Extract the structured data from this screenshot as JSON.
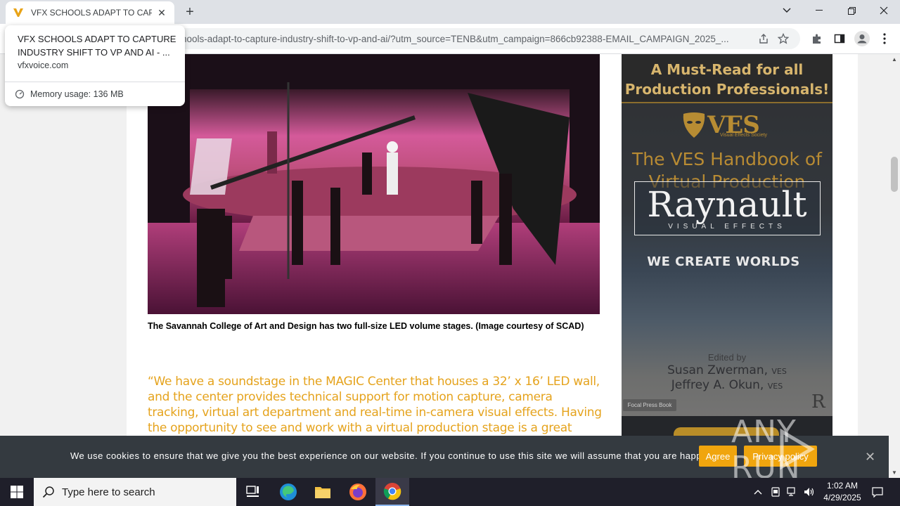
{
  "browser": {
    "tab_title": "VFX SCHOOLS ADAPT TO CAPTU",
    "url": "hools-adapt-to-capture-industry-shift-to-vp-and-ai/?utm_source=TENB&utm_campaign=866cb92388-EMAIL_CAMPAIGN_2025_...",
    "hover_card": {
      "title": "VFX SCHOOLS ADAPT TO CAPTURE INDUSTRY SHIFT TO VP AND AI - ...",
      "domain": "vfxvoice.com",
      "memory": "Memory usage: 136 MB"
    }
  },
  "article": {
    "caption": "The Savannah College of Art and Design has two full-size LED volume stages. (Image courtesy of SCAD)",
    "quote": "“We have a soundstage in the MAGIC Center that houses a 32’ x 16’ LED wall, and the center provides technical support for motion capture, camera tracking, virtual art department and real-time in-camera visual effects. Having the opportunity to see and work with a virtual production stage is a great asset for our graduates.”"
  },
  "ad": {
    "headline": "A Must-Read for all Production Professionals!",
    "ves_logo": "VES",
    "ves_sub": "Visual Effects Society",
    "book_title": "The VES Handbook of Virtual Production",
    "brand": "Raynault",
    "brand_sub": "VISUAL EFFECTS",
    "tagline": "WE CREATE WORLDS",
    "edited_by": "Edited by",
    "author1": "Susan Zwerman,",
    "author2": "Jeffrey A. Okun,",
    "author_suffix": "VES",
    "publisher": "Focal Press Book"
  },
  "cookie": {
    "text": "We use cookies to ensure that we give you the best experience on our website. If you continue to use this site we will assume that you are happy with it.",
    "agree": "Agree",
    "privacy": "Privacy policy"
  },
  "watermark": "ANY RUN",
  "taskbar": {
    "search_placeholder": "Type here to search",
    "time": "1:02 AM",
    "date": "4/29/2025"
  },
  "colors": {
    "quote": "#e5a31d",
    "cookie_button": "#f0a50e",
    "cookie_bar": "#343a40"
  }
}
